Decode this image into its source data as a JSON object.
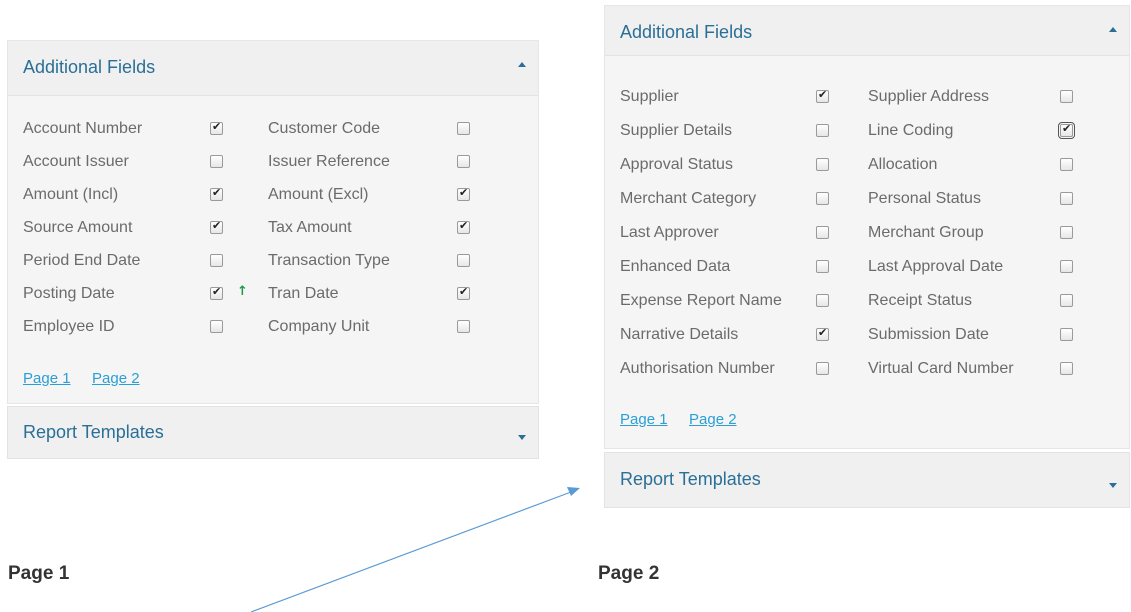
{
  "panel1": {
    "title": "Additional Fields",
    "left_fields": [
      {
        "label": "Account Number",
        "checked": true
      },
      {
        "label": "Account Issuer",
        "checked": false
      },
      {
        "label": "Amount (Incl)",
        "checked": true
      },
      {
        "label": "Source Amount",
        "checked": true
      },
      {
        "label": "Period End Date",
        "checked": false
      },
      {
        "label": "Posting Date",
        "checked": true
      },
      {
        "label": "Employee ID",
        "checked": false
      }
    ],
    "right_fields": [
      {
        "label": "Customer Code",
        "checked": false
      },
      {
        "label": "Issuer Reference",
        "checked": false
      },
      {
        "label": "Amount (Excl)",
        "checked": true
      },
      {
        "label": "Tax Amount",
        "checked": true
      },
      {
        "label": "Transaction Type",
        "checked": false
      },
      {
        "label": "Tran Date",
        "checked": true
      },
      {
        "label": "Company Unit",
        "checked": false
      }
    ],
    "sort_arrow": "↑",
    "page_links": [
      "Page 1",
      "Page 2"
    ],
    "report_templates": "Report Templates"
  },
  "panel2": {
    "title": "Additional Fields",
    "left_fields": [
      {
        "label": "Supplier",
        "checked": true
      },
      {
        "label": "Supplier Details",
        "checked": false
      },
      {
        "label": "Approval Status",
        "checked": false
      },
      {
        "label": "Merchant Category",
        "checked": false
      },
      {
        "label": "Last Approver",
        "checked": false
      },
      {
        "label": "Enhanced Data",
        "checked": false
      },
      {
        "label": "Expense Report Name",
        "checked": false
      },
      {
        "label": "Narrative Details",
        "checked": true
      },
      {
        "label": "Authorisation Number",
        "checked": false
      }
    ],
    "right_fields": [
      {
        "label": "Supplier Address",
        "checked": false
      },
      {
        "label": "Line Coding",
        "checked": true
      },
      {
        "label": "Allocation",
        "checked": false
      },
      {
        "label": "Personal Status",
        "checked": false
      },
      {
        "label": "Merchant Group",
        "checked": false
      },
      {
        "label": "Last Approval Date",
        "checked": false
      },
      {
        "label": "Receipt Status",
        "checked": false
      },
      {
        "label": "Submission Date",
        "checked": false
      },
      {
        "label": "Virtual Card Number",
        "checked": false
      }
    ],
    "page_links": [
      "Page 1",
      "Page 2"
    ],
    "report_templates": "Report Templates"
  },
  "captions": {
    "page1": "Page 1",
    "page2": "Page 2"
  },
  "colors": {
    "header_text": "#2a6f97",
    "link": "#2a9fd6",
    "label_text": "#6b6b6b",
    "arrow_line": "#5b9bd5",
    "sort_arrow": "#1f9b4a"
  }
}
